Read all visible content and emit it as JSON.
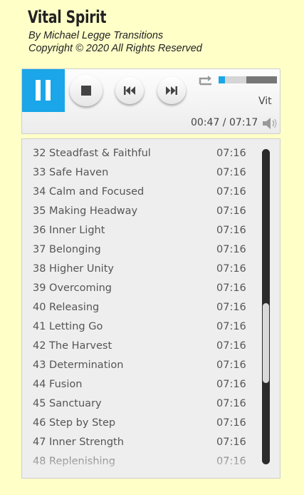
{
  "header": {
    "title": "Vital Spirit",
    "byline": "By Michael Legge Transitions",
    "copyright": "Copyright © 2020 All Rights Reserved"
  },
  "player": {
    "now_playing": "Vit",
    "current_time": "00:47",
    "total_time": "07:17",
    "time_display": "00:47 / 07:17",
    "progress_played_fraction": 0.11,
    "progress_loaded_fraction": 0.48,
    "accent_color": "#1aa6e8",
    "icons": [
      "pause-icon",
      "stop-icon",
      "previous-icon",
      "next-icon",
      "repeat-icon",
      "volume-icon"
    ]
  },
  "playlist": {
    "tracks": [
      {
        "label": "32 Steadfast & Faithful",
        "duration": "07:16"
      },
      {
        "label": "33 Safe Haven",
        "duration": "07:16"
      },
      {
        "label": "34 Calm and Focused",
        "duration": "07:16"
      },
      {
        "label": "35 Making Headway",
        "duration": "07:16"
      },
      {
        "label": "36 Inner Light",
        "duration": "07:16"
      },
      {
        "label": "37 Belonging",
        "duration": "07:16"
      },
      {
        "label": "38 Higher Unity",
        "duration": "07:16"
      },
      {
        "label": "39 Overcoming",
        "duration": "07:16"
      },
      {
        "label": "40 Releasing",
        "duration": "07:16"
      },
      {
        "label": "41 Letting Go",
        "duration": "07:16"
      },
      {
        "label": "42 The Harvest",
        "duration": "07:16"
      },
      {
        "label": "43 Determination",
        "duration": "07:16"
      },
      {
        "label": "44 Fusion",
        "duration": "07:16"
      },
      {
        "label": "45 Sanctuary",
        "duration": "07:16"
      },
      {
        "label": "46 Step by Step",
        "duration": "07:16"
      },
      {
        "label": "47 Inner Strength",
        "duration": "07:16"
      },
      {
        "label": "48 Replenishing",
        "duration": "07:16"
      }
    ]
  }
}
